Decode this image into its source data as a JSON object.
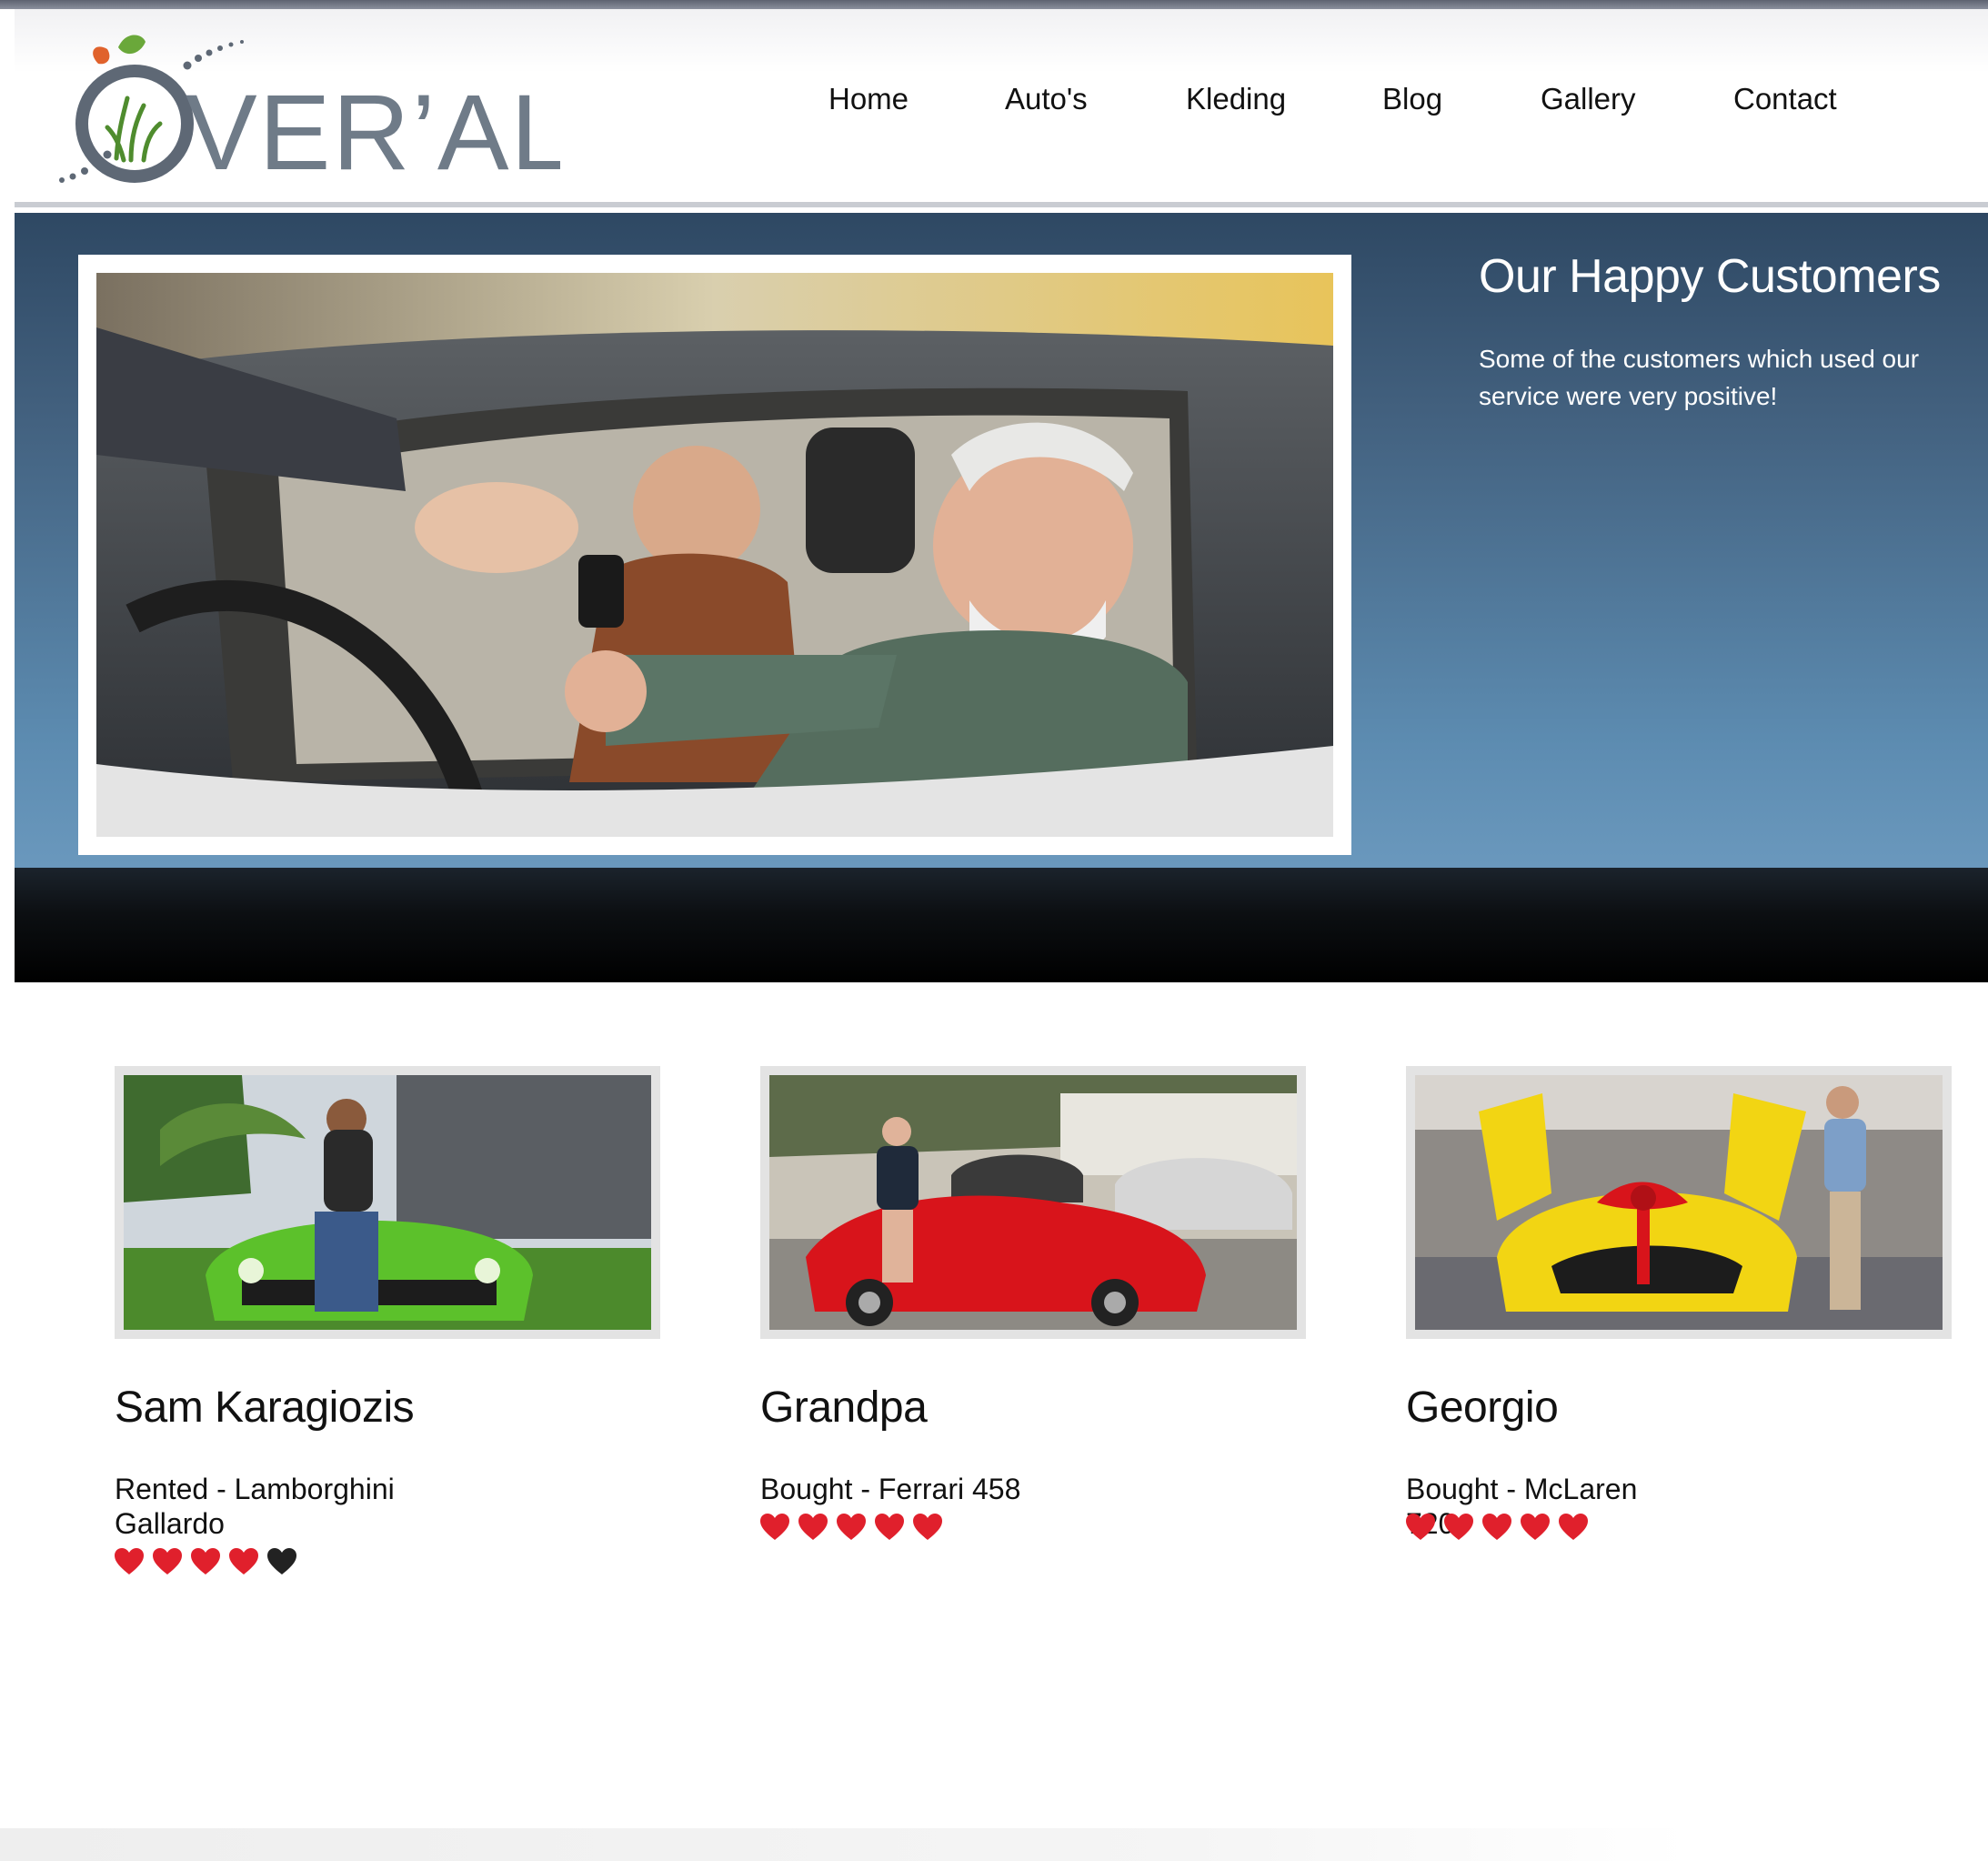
{
  "brand": {
    "logo_text": "OVER'ALL",
    "colors": {
      "logo_grey": "#6f7b88",
      "leaf_orange": "#e0622c",
      "leaf_green": "#6aa83a"
    }
  },
  "nav": {
    "items": [
      "Home",
      "Auto's",
      "Kleding",
      "Blog",
      "Gallery",
      "Contact"
    ]
  },
  "hero": {
    "title": "Our Happy Customers",
    "text": "Some of the customers which used our service were very positive!",
    "colors": {
      "gradient_top": "#2e4863",
      "gradient_bottom": "#6a98bd"
    }
  },
  "customers": [
    {
      "name": "Sam Karagiozis",
      "desc": "Rented - Lamborghini Gallardo",
      "rating": 4,
      "max_rating": 5,
      "car_color": "#5cc12b"
    },
    {
      "name": "Grandpa",
      "desc": "Bought - Ferrari 458",
      "rating": 5,
      "max_rating": 5,
      "car_color": "#d8141b"
    },
    {
      "name": "Georgio",
      "desc": "Bought - McLaren 720s",
      "rating": 5,
      "max_rating": 5,
      "car_color": "#f2d513"
    }
  ],
  "icons": {
    "heart_full": "red-heart-icon",
    "heart_empty": "black-heart-icon",
    "heart_full_color": "#e0202c",
    "heart_empty_color": "#222222"
  }
}
